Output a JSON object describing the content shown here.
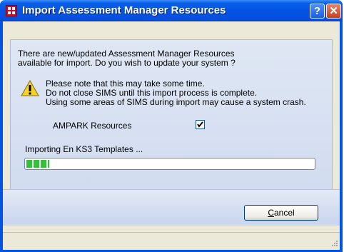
{
  "window": {
    "title": "Import Assessment Manager Resources",
    "help_button": "?",
    "close_button": "✕"
  },
  "message": {
    "line1": "There are new/updated Assessment Manager Resources",
    "line2": "available for import. Do you wish to update your system ?"
  },
  "warning": {
    "line1": "Please note that this may take some time.",
    "line2": "Do not close SIMS until this import process is complete.",
    "line3": "Using some areas of SIMS during import may cause a system crash."
  },
  "ampark": {
    "label": "AMPARK Resources",
    "checked": true
  },
  "progress": {
    "status": "Importing En KS3 Templates ...",
    "fraction": 0.08
  },
  "buttons": {
    "cancel_prefix": "",
    "cancel_mnemonic": "C",
    "cancel_rest": "ancel"
  },
  "icons": {
    "title": "sims-app-icon",
    "warning": "warning-icon",
    "help": "help-icon",
    "close": "close-icon"
  },
  "colors": {
    "titlebar": "#0454e3",
    "progress": "#35c03a",
    "close": "#c6421f"
  }
}
